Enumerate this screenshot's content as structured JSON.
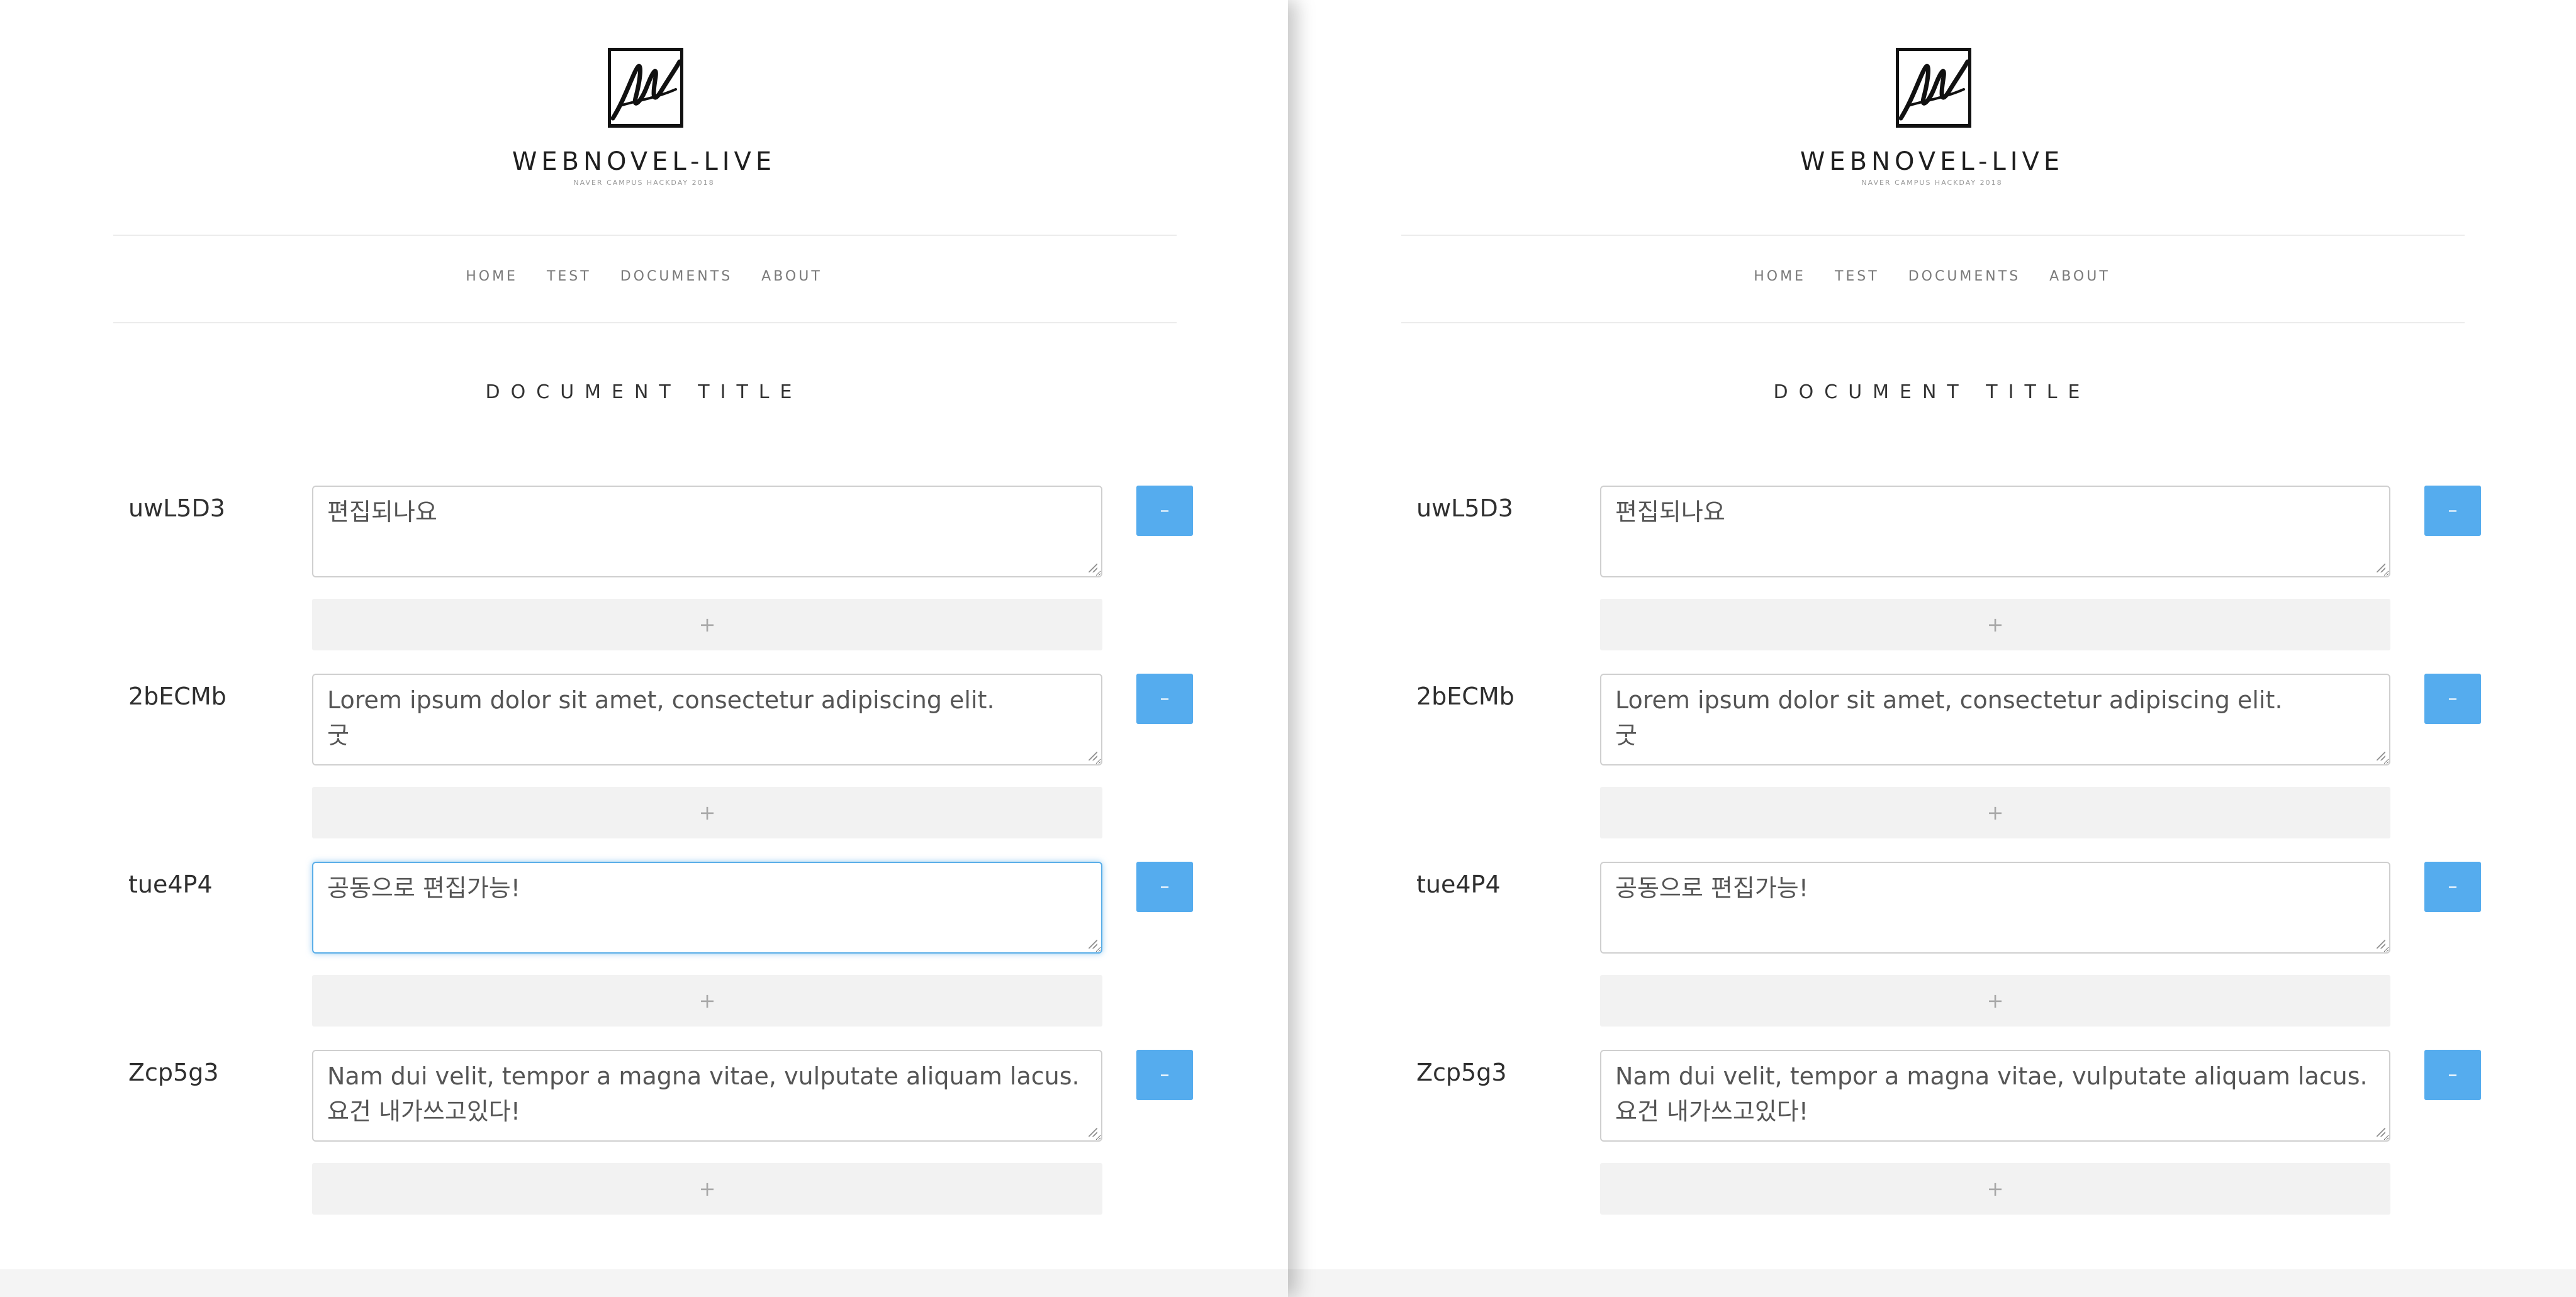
{
  "site": {
    "title": "WEBNOVEL-LIVE",
    "subtitle": "NAVER CAMPUS HACKDAY 2018"
  },
  "nav": {
    "home": "HOME",
    "test": "TEST",
    "documents": "DOCUMENTS",
    "about": "ABOUT"
  },
  "document": {
    "title": "DOCUMENT TITLE"
  },
  "controls": {
    "remove_label": "–",
    "add_label": "+"
  },
  "paragraphs": [
    {
      "id": "uwL5D3",
      "text": "편집되나요"
    },
    {
      "id": "2bECMb",
      "text": "Lorem ipsum dolor sit amet, consectetur adipiscing elit.\n굿"
    },
    {
      "id": "tue4P4",
      "text": "공동으로 편집가능!"
    },
    {
      "id": "Zcp5g3",
      "text": "Nam dui velit, tempor a magna vitae, vulputate aliquam lacus.\n요건 내가쓰고있다!"
    }
  ],
  "focus": {
    "left_window_focused_paragraph": "tue4P4"
  },
  "colors": {
    "accent_button": "#55acee",
    "focus_ring": "#5aaee8",
    "add_bar": "#f2f2f2"
  },
  "icons": {
    "logo": "webnovel-w-logo"
  }
}
